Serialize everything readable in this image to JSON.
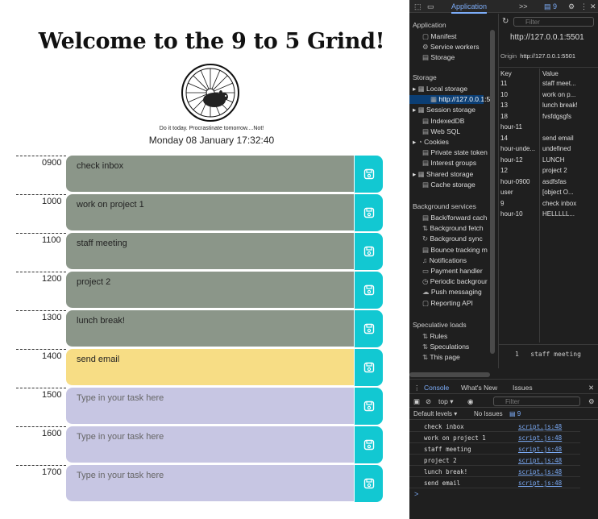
{
  "planner": {
    "title": "Welcome to the 9 to 5 Grind!",
    "tagline": "Do it today. Procrastinate tomorrow....Not!",
    "date": "Monday 08 January 17:32:40",
    "placeholder": "Type in your task here",
    "rows": [
      {
        "hour": "0900",
        "task": "check inbox",
        "state": "past"
      },
      {
        "hour": "1000",
        "task": "work on project 1",
        "state": "past"
      },
      {
        "hour": "1100",
        "task": "staff meeting",
        "state": "past"
      },
      {
        "hour": "1200",
        "task": "project 2",
        "state": "past"
      },
      {
        "hour": "1300",
        "task": "lunch break!",
        "state": "past"
      },
      {
        "hour": "1400",
        "task": "send email",
        "state": "present"
      },
      {
        "hour": "1500",
        "task": "",
        "state": "future"
      },
      {
        "hour": "1600",
        "task": "",
        "state": "future"
      },
      {
        "hour": "1700",
        "task": "",
        "state": "future"
      }
    ],
    "colors": {
      "past": "#8b9689",
      "present": "#f7dd85",
      "future": "#c7c6e3",
      "save": "#12c8d2"
    }
  },
  "devtools": {
    "tabs": {
      "active": "Application",
      "more": ">>",
      "badge": "9"
    },
    "sidebar": {
      "application_header": "Application",
      "application_items": [
        "Manifest",
        "Service workers",
        "Storage"
      ],
      "storage_header": "Storage",
      "storage_items": [
        "Local storage",
        "http://127.0.0.1:5",
        "Session storage",
        "IndexedDB",
        "Web SQL",
        "Cookies",
        "Private state token",
        "Interest groups",
        "Shared storage",
        "Cache storage"
      ],
      "background_header": "Background services",
      "background_items": [
        "Back/forward cach",
        "Background fetch",
        "Background sync",
        "Bounce tracking m",
        "Notifications",
        "Payment handler",
        "Periodic backgrour",
        "Push messaging",
        "Reporting API"
      ],
      "speculative_header": "Speculative loads",
      "speculative_items": [
        "Rules",
        "Speculations",
        "This page"
      ]
    },
    "panel": {
      "filter_placeholder": "Filter",
      "url": "http://127.0.0.1:5501",
      "origin_label": "Origin",
      "origin_value": "http://127.0.0.1:5501",
      "key_header": "Key",
      "value_header": "Value",
      "entries": [
        {
          "key": "11",
          "value": "staff meet..."
        },
        {
          "key": "10",
          "value": "work on p..."
        },
        {
          "key": "13",
          "value": "lunch break!"
        },
        {
          "key": "18",
          "value": "fvsfdgsgfs"
        },
        {
          "key": "hour-11",
          "value": ""
        },
        {
          "key": "14",
          "value": "send email"
        },
        {
          "key": "hour-unde...",
          "value": "undefined"
        },
        {
          "key": "hour-12",
          "value": "LUNCH"
        },
        {
          "key": "12",
          "value": "project 2"
        },
        {
          "key": "hour-0900",
          "value": "asdfsfas"
        },
        {
          "key": "user",
          "value": "[object O..."
        },
        {
          "key": "9",
          "value": "check inbox"
        },
        {
          "key": "hour-10",
          "value": "HELLLLL..."
        }
      ],
      "preview_index": "1",
      "preview_value": "staff meeting"
    },
    "console": {
      "tabs": [
        "Console",
        "What's New",
        "Issues"
      ],
      "context": "top",
      "filter_placeholder": "Filter",
      "levels": "Default levels",
      "issues": "No Issues",
      "issue_count": "9",
      "logs": [
        {
          "text": "check inbox",
          "src": "script.js:48"
        },
        {
          "text": "work on project 1",
          "src": "script.js:48"
        },
        {
          "text": "staff meeting",
          "src": "script.js:48"
        },
        {
          "text": "project 2",
          "src": "script.js:48"
        },
        {
          "text": "lunch break!",
          "src": "script.js:48"
        },
        {
          "text": "send email",
          "src": "script.js:48"
        }
      ],
      "prompt": ">"
    }
  }
}
